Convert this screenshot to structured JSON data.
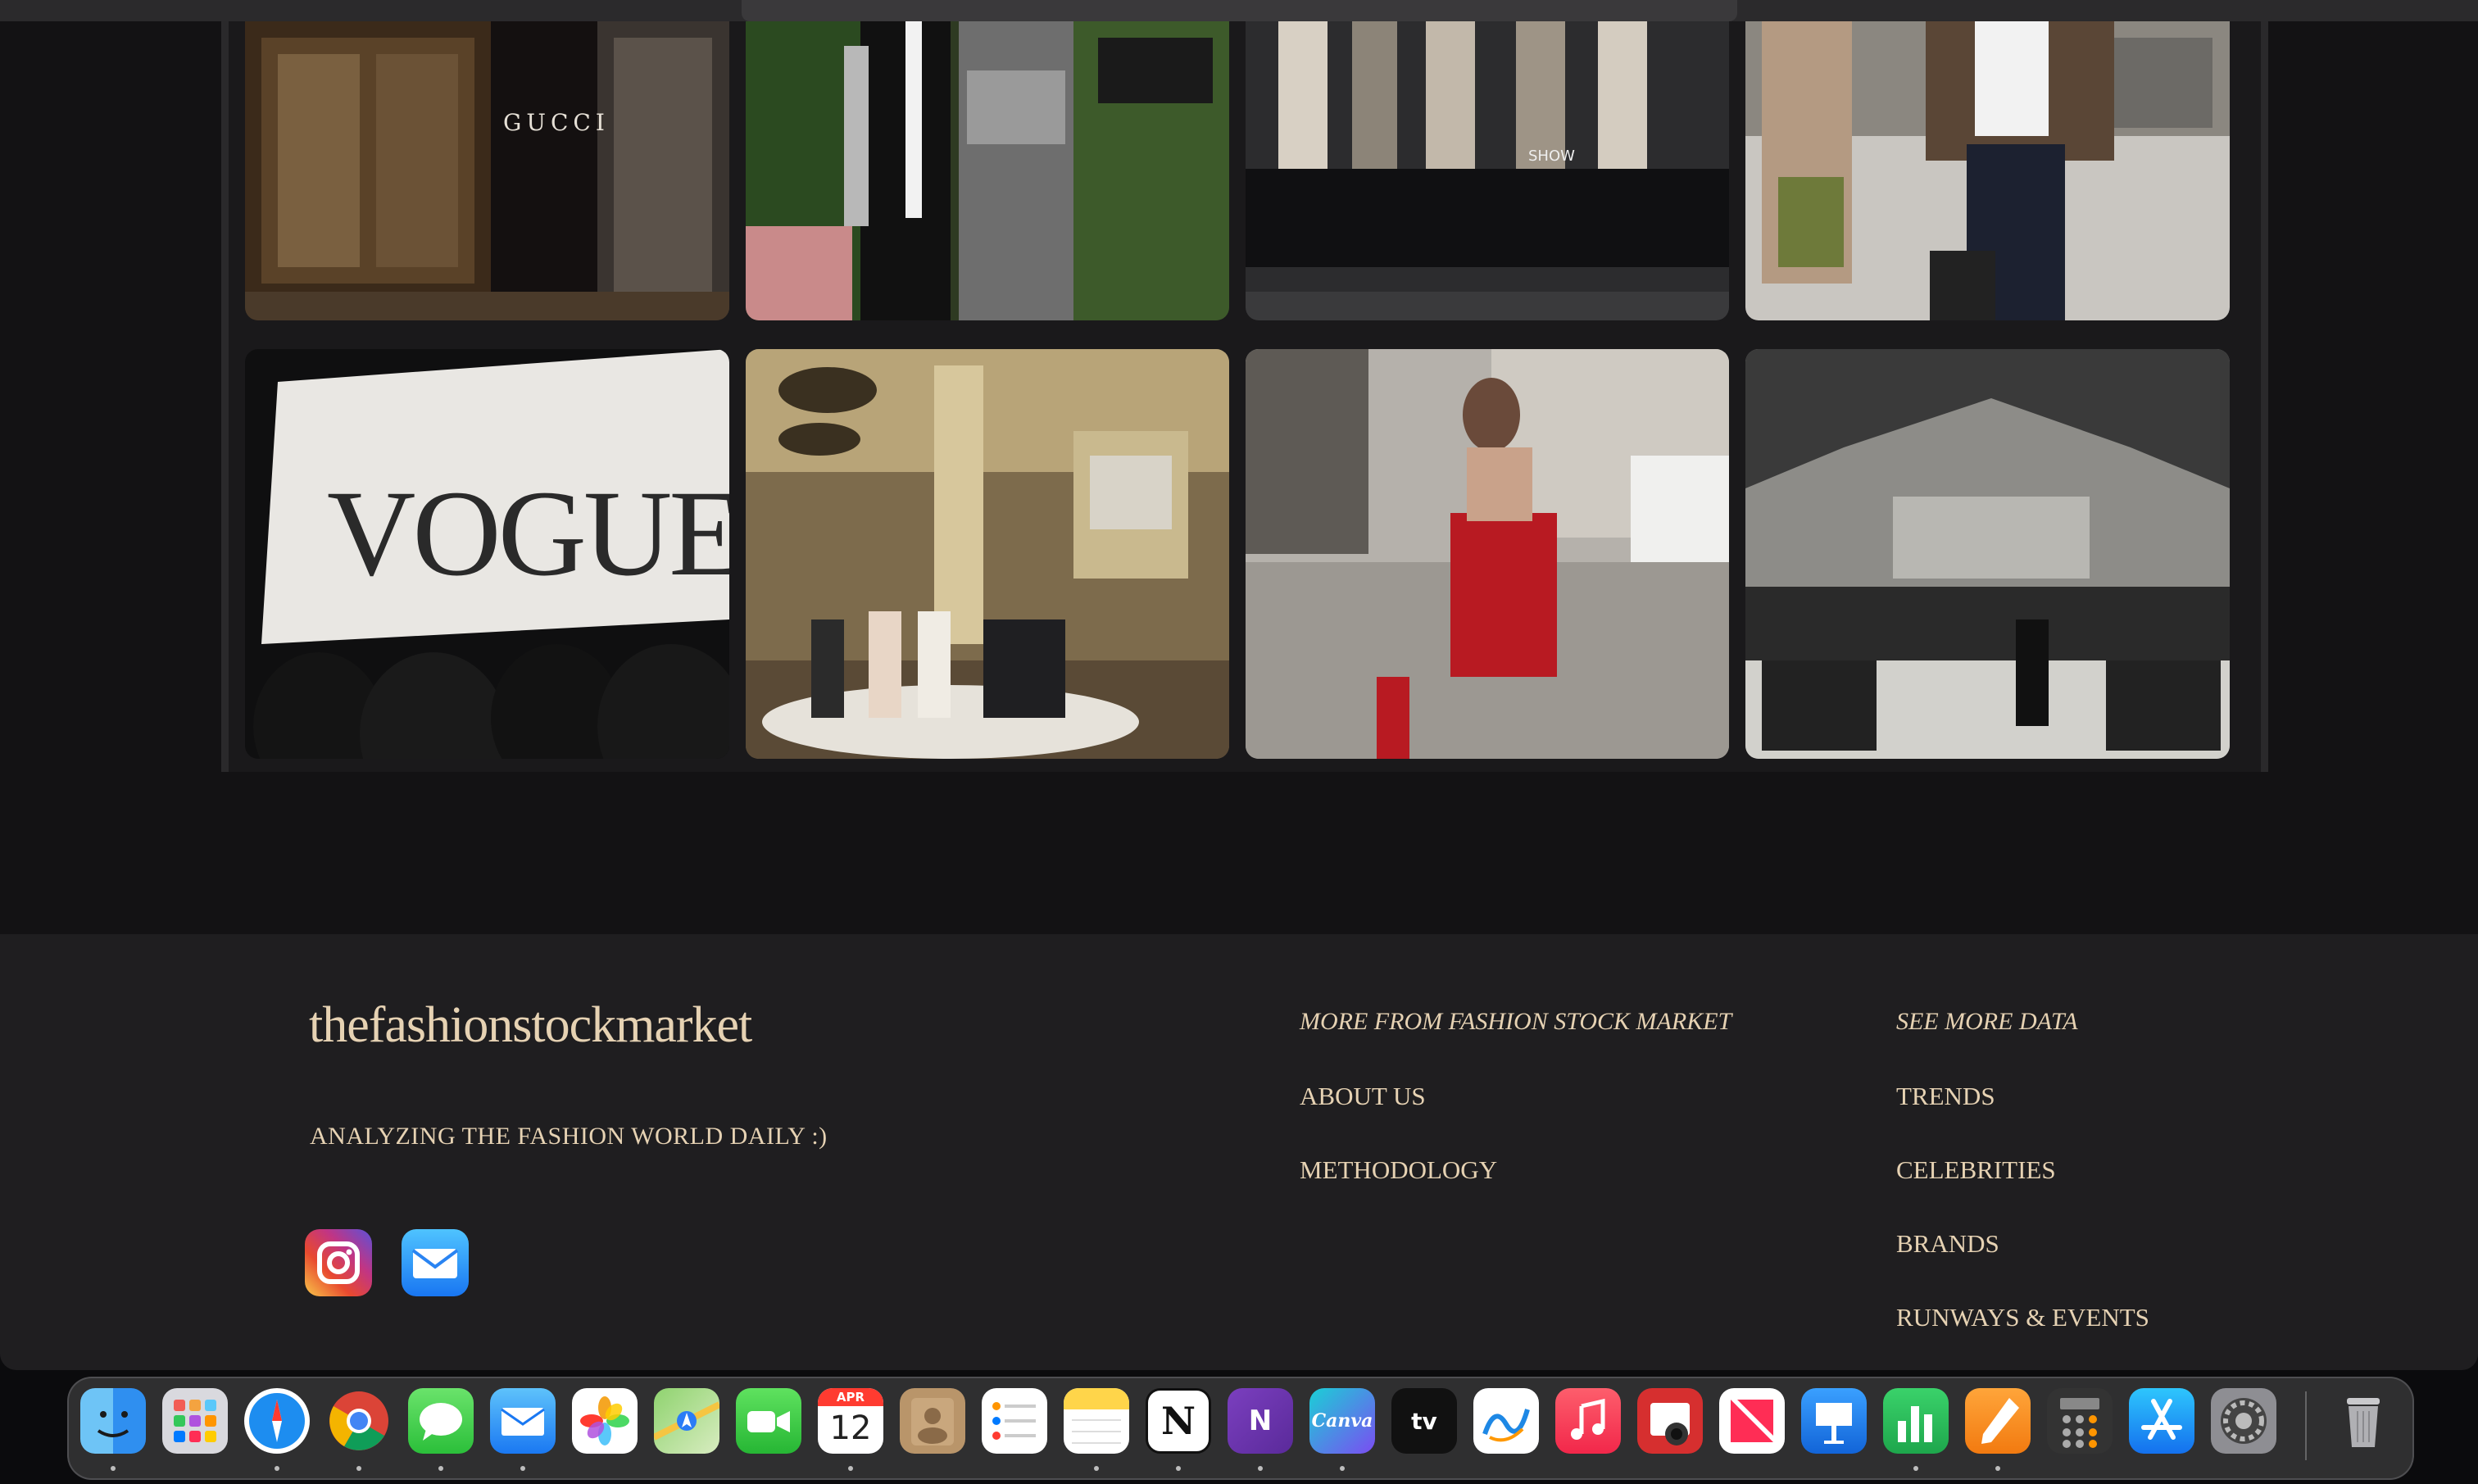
{
  "footer": {
    "brand": "thefashionstockmarket",
    "tagline": "ANALYZING THE FASHION WORLD DAILY :)",
    "col1": {
      "heading": "MORE FROM FASHION STOCK MARKET",
      "links": [
        "ABOUT US",
        "METHODOLOGY"
      ]
    },
    "col2": {
      "heading": "SEE MORE DATA",
      "links": [
        "TRENDS",
        "CELEBRITIES",
        "BRANDS",
        "RUNWAYS & EVENTS"
      ]
    }
  },
  "gallery": {
    "row1": [
      {
        "name": "gucci-storefront",
        "text": "GUCCI"
      },
      {
        "name": "met-gala-couple",
        "text": ""
      },
      {
        "name": "runway-on-laptop",
        "text": "SHOW"
      },
      {
        "name": "street-style-jacket",
        "text": ""
      }
    ],
    "row2": [
      {
        "name": "vogue-mexico-event",
        "text": "VOGUE"
      },
      {
        "name": "dior-museum-exhibit",
        "text": ""
      },
      {
        "name": "red-dress-street-style",
        "text": ""
      },
      {
        "name": "chanel-eiffel-runway",
        "text": ""
      }
    ]
  },
  "dock": {
    "calendar_month": "APR",
    "calendar_day": "12",
    "apps": [
      {
        "name": "finder-icon"
      },
      {
        "name": "launchpad-icon"
      },
      {
        "name": "safari-icon"
      },
      {
        "name": "chrome-icon"
      },
      {
        "name": "messages-icon"
      },
      {
        "name": "mail-icon"
      },
      {
        "name": "photos-icon"
      },
      {
        "name": "maps-icon"
      },
      {
        "name": "facetime-icon"
      },
      {
        "name": "calendar-icon"
      },
      {
        "name": "contacts-icon"
      },
      {
        "name": "reminders-icon"
      },
      {
        "name": "notes-icon"
      },
      {
        "name": "notion-icon"
      },
      {
        "name": "onenote-icon"
      },
      {
        "name": "canva-icon"
      },
      {
        "name": "apple-tv-icon"
      },
      {
        "name": "freeform-icon"
      },
      {
        "name": "music-icon"
      },
      {
        "name": "photo-booth-icon"
      },
      {
        "name": "news-icon"
      },
      {
        "name": "keynote-icon"
      },
      {
        "name": "numbers-icon"
      },
      {
        "name": "pages-icon"
      },
      {
        "name": "calculator-icon"
      },
      {
        "name": "app-store-icon"
      },
      {
        "name": "system-settings-icon"
      },
      {
        "name": "trash-icon"
      }
    ],
    "labels": {
      "notion": "N",
      "onenote": "N",
      "canva": "Canva",
      "tv": "tv"
    }
  }
}
